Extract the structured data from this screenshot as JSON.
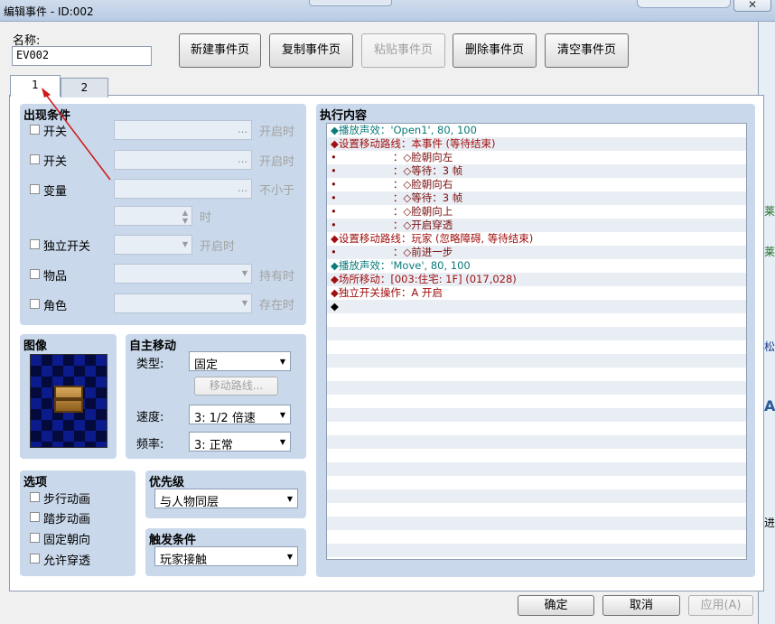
{
  "window": {
    "title": "编辑事件 - ID:002"
  },
  "name_field": {
    "label": "名称:",
    "value": "EV002"
  },
  "toolbar": {
    "new_page": "新建事件页",
    "copy_page": "复制事件页",
    "paste_page": "粘贴事件页",
    "delete_page": "删除事件页",
    "clear_page": "清空事件页"
  },
  "tabs": [
    "1",
    "2"
  ],
  "conditions": {
    "title": "出现条件",
    "switch1": {
      "label": "开关",
      "suffix": "开启时"
    },
    "switch2": {
      "label": "开关",
      "suffix": "开启时"
    },
    "variable": {
      "label": "变量",
      "suffix": "不小于",
      "suffix2": "时"
    },
    "self_switch": {
      "label": "独立开关",
      "suffix": "开启时"
    },
    "item": {
      "label": "物品",
      "suffix": "持有时"
    },
    "actor": {
      "label": "角色",
      "suffix": "存在时"
    }
  },
  "image": {
    "title": "图像"
  },
  "autonomous": {
    "title": "自主移动",
    "type_label": "类型:",
    "type_value": "固定",
    "route_button": "移动路线...",
    "speed_label": "速度:",
    "speed_value": "3: 1/2 倍速",
    "freq_label": "频率:",
    "freq_value": "3: 正常"
  },
  "options": {
    "title": "选项",
    "items": [
      "步行动画",
      "踏步动画",
      "固定朝向",
      "允许穿透"
    ]
  },
  "priority": {
    "title": "优先级",
    "value": "与人物同层"
  },
  "trigger": {
    "title": "触发条件",
    "value": "玩家接触"
  },
  "exec": {
    "title": "执行内容",
    "lines": [
      "◆播放声效：'Open1', 80, 100",
      "◆设置移动路线：本事件 (等待结束)",
      "•                 ：◇脸朝向左",
      "•                 ：◇等待：3 帧",
      "•                 ：◇脸朝向右",
      "•                 ：◇等待：3 帧",
      "•                 ：◇脸朝向上",
      "•                 ：◇开启穿透",
      "◆设置移动路线：玩家 (忽略障碍, 等待结束)",
      "•                 ：◇前进一步",
      "◆播放声效：'Move', 80, 100",
      "◆场所移动：[003:住宅: 1F] (017,028)",
      "◆独立开关操作：A 开启",
      "◆"
    ],
    "line_colors": [
      "teal",
      "red",
      "dark",
      "dark",
      "dark",
      "dark",
      "dark",
      "dark",
      "red",
      "dark",
      "teal",
      "red",
      "red",
      "black"
    ]
  },
  "footer": {
    "ok": "确定",
    "cancel": "取消",
    "apply": "应用(A)"
  },
  "background": {
    "side_texts": [
      "莱",
      "莱",
      "松",
      "A",
      "进"
    ]
  }
}
